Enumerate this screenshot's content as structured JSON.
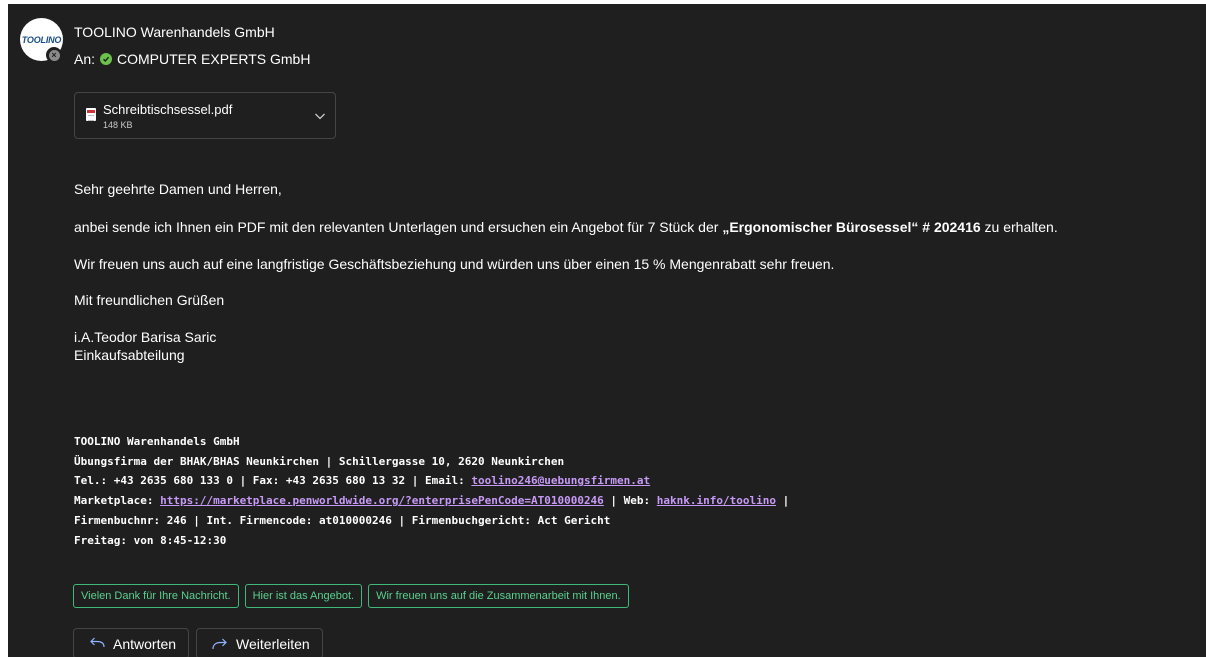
{
  "sender": {
    "name": "TOOLINO Warenhandels GmbH",
    "avatar_text": "TOOLINO"
  },
  "recipient": {
    "prefix": "An:",
    "name": "COMPUTER EXPERTS GmbH"
  },
  "attachment": {
    "name": "Schreibtischsessel.pdf",
    "size": "148 KB"
  },
  "body": {
    "greeting": "Sehr geehrte Damen und Herren,",
    "para1_before": "anbei sende ich Ihnen ein PDF mit den relevanten Unterlagen und ersuchen ein Angebot für 7 Stück der ",
    "para1_bold": "„Ergonomischer Bürosessel“ # 202416",
    "para1_after": " zu erhalten.",
    "para2": "Wir freuen uns auch auf eine langfristige Geschäftsbeziehung und würden uns über einen 15 % Mengenrabatt sehr freuen.",
    "closing": "Mit freundlichen Grüßen",
    "signer_name": "i.A.Teodor Barisa Saric",
    "signer_dept": "Einkaufsabteilung"
  },
  "signature": {
    "line1": "TOOLINO Warenhandels GmbH",
    "line2": "Übungsfirma der BHAK/BHAS Neunkirchen | Schillergasse 10, 2620 Neunkirchen",
    "line3_prefix": "Tel.: +43 2635 680 133 0 | Fax: +43 2635 680 13 32 | Email: ",
    "email": "toolino246@uebungsfirmen.at",
    "line4_prefix": "Marketplace: ",
    "marketplace_url": "https://marketplace.penworldwide.org/?enterprisePenCode=AT010000246",
    "line4_mid": " | Web: ",
    "web": "haknk.info/toolino",
    "line4_suffix": " |",
    "line5": "Firmenbuchnr: 246 | Int. Firmencode: at010000246 | Firmenbuchgericht: Act Gericht",
    "line6": "Freitag: von 8:45-12:30"
  },
  "suggested_replies": [
    "Vielen Dank für Ihre Nachricht.",
    "Hier ist das Angebot.",
    "Wir freuen uns auf die Zusammenarbeit mit Ihnen."
  ],
  "actions": {
    "reply": "Antworten",
    "forward": "Weiterleiten"
  },
  "colors": {
    "background": "#1f1f1f",
    "suggestion_accent": "#3fb97a",
    "link": "#c79af7",
    "presence_ok": "#6cc24a"
  }
}
